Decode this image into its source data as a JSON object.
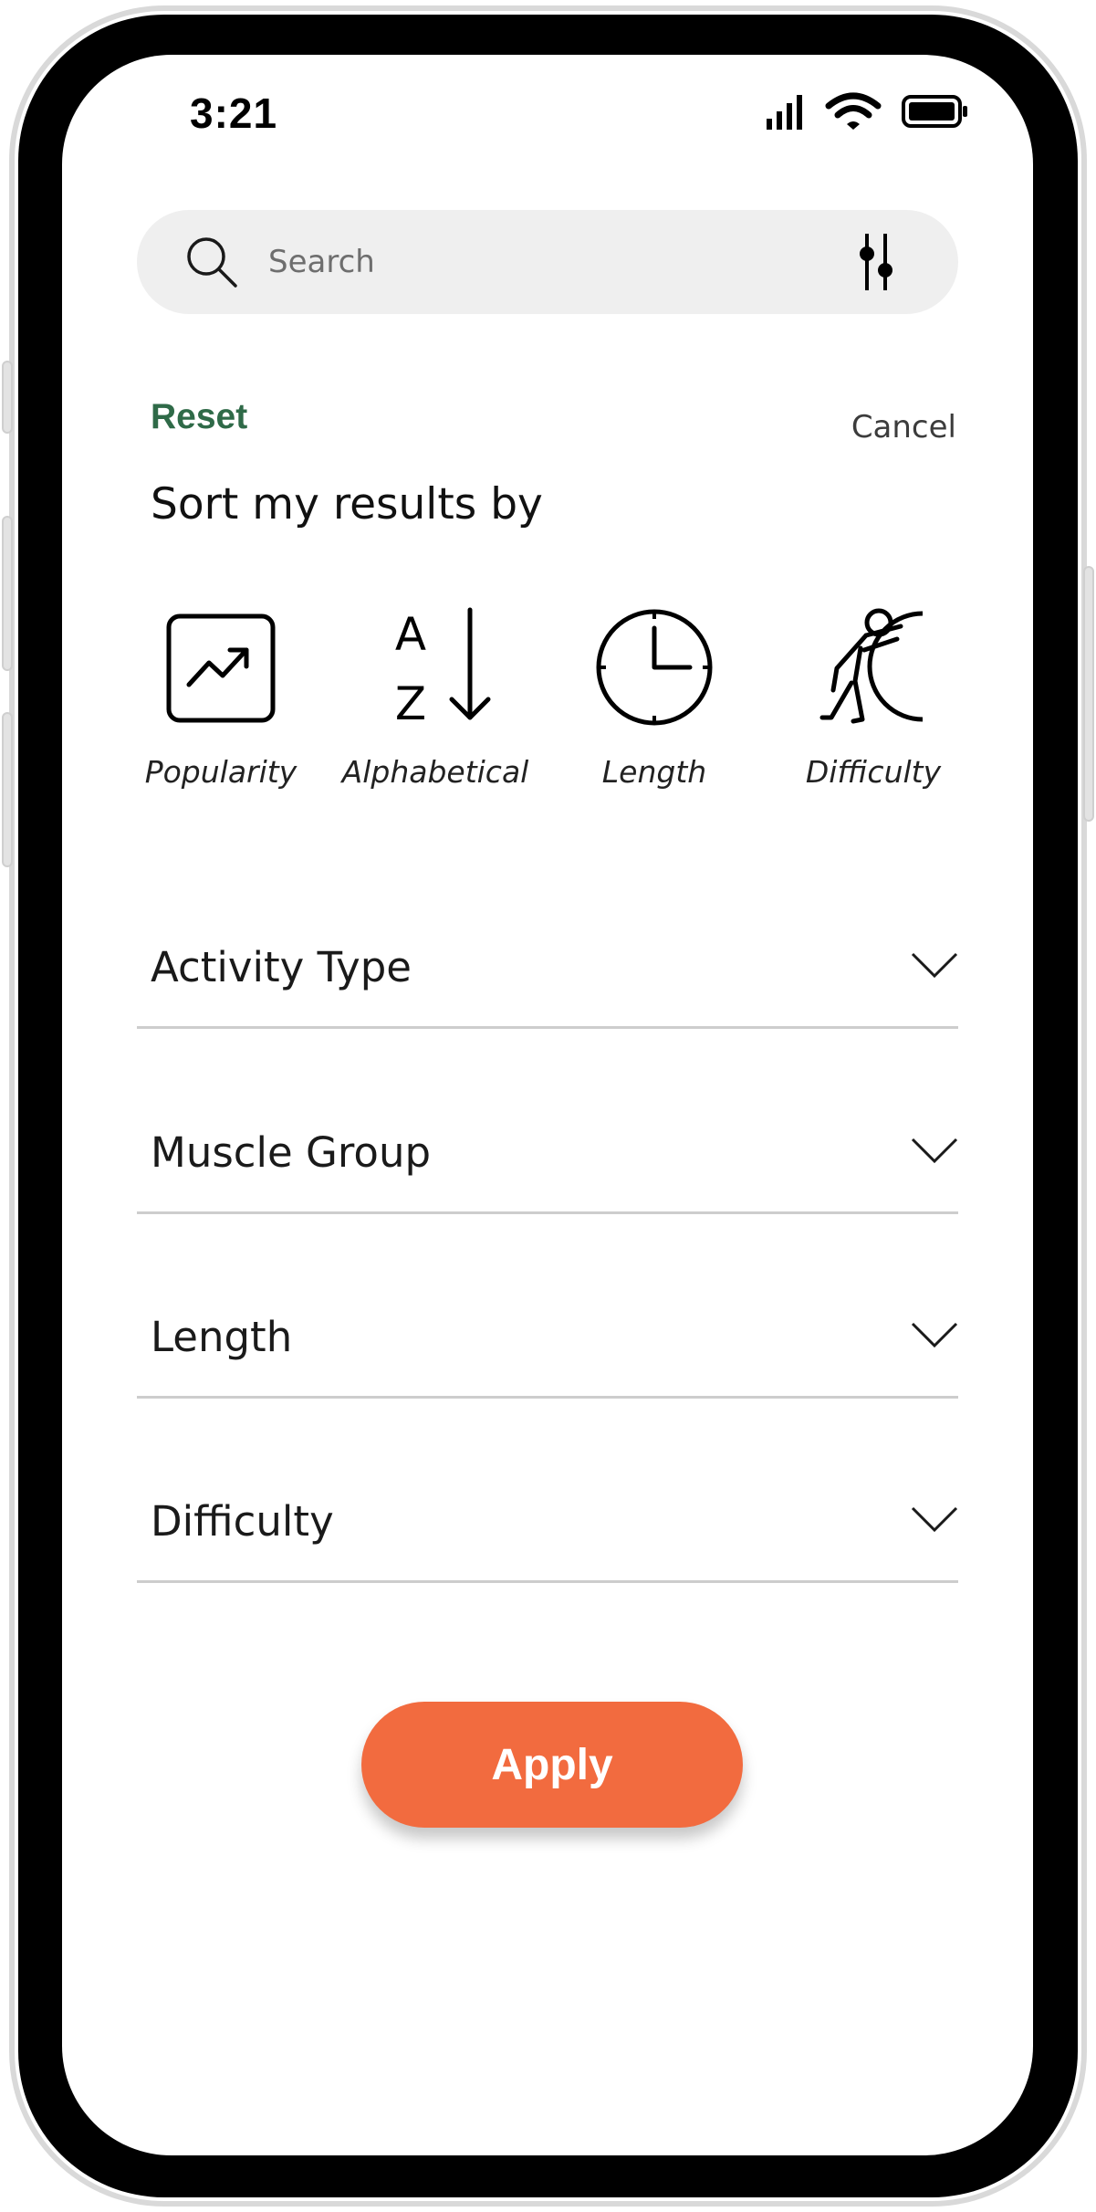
{
  "status_bar": {
    "time": "3:21",
    "icons": [
      "cellular-signal-icon",
      "wifi-icon",
      "battery-icon"
    ]
  },
  "search": {
    "placeholder": "Search",
    "value": "",
    "icons": [
      "search-icon",
      "filter-sliders-icon"
    ]
  },
  "header": {
    "reset_label": "Reset",
    "cancel_label": "Cancel",
    "sort_title": "Sort my results by"
  },
  "sort_options": [
    {
      "label": "Popularity",
      "icon": "trending-up-icon"
    },
    {
      "label": "Alphabetical",
      "icon": "az-sort-icon"
    },
    {
      "label": "Length",
      "icon": "clock-icon"
    },
    {
      "label": "Difficulty",
      "icon": "pushing-boulder-icon"
    }
  ],
  "filters": [
    {
      "label": "Activity Type",
      "icon": "chevron-down-icon"
    },
    {
      "label": "Muscle Group",
      "icon": "chevron-down-icon"
    },
    {
      "label": "Length",
      "icon": "chevron-down-icon"
    },
    {
      "label": "Difficulty",
      "icon": "chevron-down-icon"
    }
  ],
  "apply_label": "Apply",
  "colors": {
    "accent": "#f26b3f",
    "reset": "#2f6a48",
    "search_bg": "#efefef",
    "divider": "#cdcdcd"
  }
}
